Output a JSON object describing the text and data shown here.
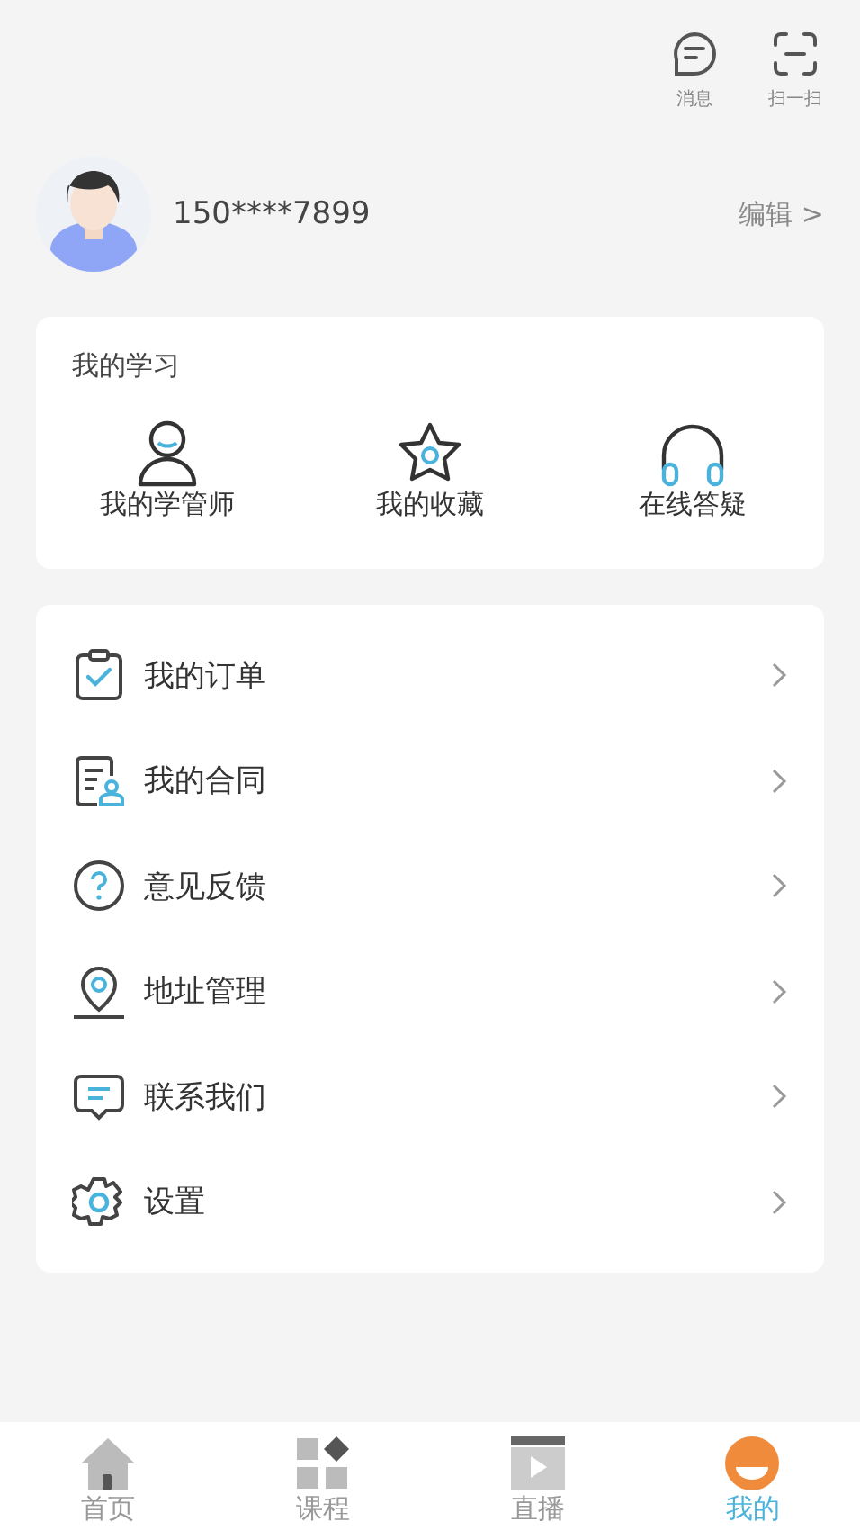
{
  "top_actions": [
    {
      "kind": "message",
      "label": "消息"
    },
    {
      "kind": "scan",
      "label": "扫一扫"
    }
  ],
  "profile": {
    "phone": "150****7899",
    "edit": "编辑",
    "chevron": ">"
  },
  "study": {
    "title": "我的学习",
    "items": [
      {
        "kind": "person",
        "label": "我的学管师"
      },
      {
        "kind": "star",
        "label": "我的收藏"
      },
      {
        "kind": "headphones",
        "label": "在线答疑"
      }
    ]
  },
  "menu": [
    {
      "kind": "order",
      "label": "我的订单"
    },
    {
      "kind": "contract",
      "label": "我的合同"
    },
    {
      "kind": "feedback",
      "label": "意见反馈"
    },
    {
      "kind": "address",
      "label": "地址管理"
    },
    {
      "kind": "contact",
      "label": "联系我们"
    },
    {
      "kind": "settings",
      "label": "设置"
    }
  ],
  "tabs": [
    {
      "kind": "home",
      "label": "首页",
      "selected": false
    },
    {
      "kind": "course",
      "label": "课程",
      "selected": false
    },
    {
      "kind": "live",
      "label": "直播",
      "selected": false
    },
    {
      "kind": "me",
      "label": "我的",
      "selected": true
    }
  ]
}
